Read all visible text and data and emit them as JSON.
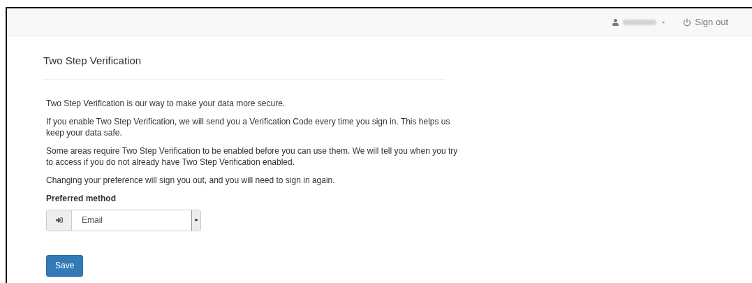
{
  "navbar": {
    "sign_out": "Sign out"
  },
  "page": {
    "title": "Two Step Verification",
    "paragraphs": [
      "Two Step Verification is our way to make your data more secure.",
      "If you enable Two Step Verification, we will send you a Verification Code every time you sign in. This helps us keep your data safe.",
      "Some areas require Two Step Verification to be enabled before you can use them. We will tell you when you try to access if you do not already have Two Step Verification enabled.",
      "Changing your preference will sign you out, and you will need to sign in again."
    ],
    "method": {
      "label": "Preferred method",
      "value": "Email"
    },
    "save": "Save"
  }
}
